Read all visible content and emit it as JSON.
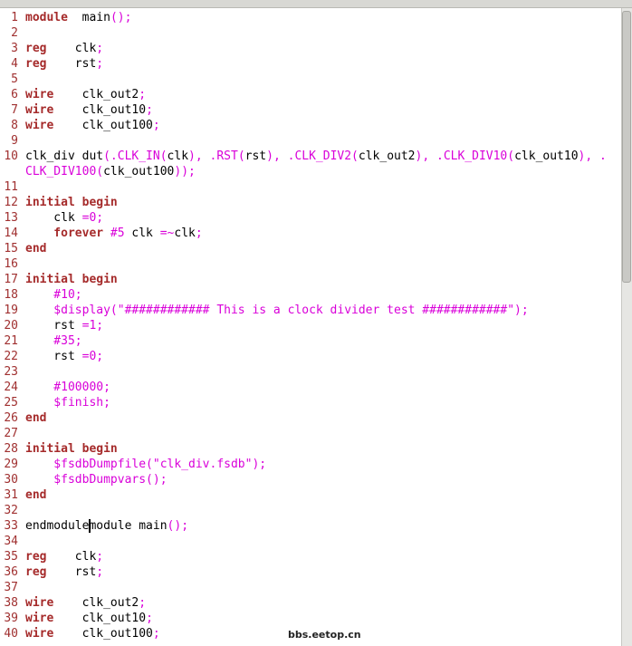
{
  "lines": [
    {
      "n": "1",
      "t": [
        [
          "kw",
          "module"
        ],
        [
          "",
          "  main"
        ],
        [
          "mg",
          "();"
        ]
      ]
    },
    {
      "n": "2",
      "t": []
    },
    {
      "n": "3",
      "t": [
        [
          "kw",
          "reg"
        ],
        [
          "",
          "    clk"
        ],
        [
          "mg",
          ";"
        ]
      ]
    },
    {
      "n": "4",
      "t": [
        [
          "kw",
          "reg"
        ],
        [
          "",
          "    rst"
        ],
        [
          "mg",
          ";"
        ]
      ]
    },
    {
      "n": "5",
      "t": []
    },
    {
      "n": "6",
      "t": [
        [
          "kw",
          "wire"
        ],
        [
          "",
          "    clk_out2"
        ],
        [
          "mg",
          ";"
        ]
      ]
    },
    {
      "n": "7",
      "t": [
        [
          "kw",
          "wire"
        ],
        [
          "",
          "    clk_out10"
        ],
        [
          "mg",
          ";"
        ]
      ]
    },
    {
      "n": "8",
      "t": [
        [
          "kw",
          "wire"
        ],
        [
          "",
          "    clk_out100"
        ],
        [
          "mg",
          ";"
        ]
      ]
    },
    {
      "n": "9",
      "t": []
    },
    {
      "n": "10",
      "t": [
        [
          "",
          "clk_div dut"
        ],
        [
          "mg",
          "(.CLK_IN("
        ],
        [
          "",
          "clk"
        ],
        [
          "mg",
          "), .RST("
        ],
        [
          "",
          "rst"
        ],
        [
          "mg",
          "), .CLK_DIV2("
        ],
        [
          "",
          "clk_out2"
        ],
        [
          "mg",
          "), .CLK_DIV10("
        ],
        [
          "",
          "clk_out10"
        ],
        [
          "mg",
          "), ."
        ]
      ]
    },
    {
      "n": "",
      "t": [
        [
          "mg",
          "CLK_DIV100("
        ],
        [
          "",
          "clk_out100"
        ],
        [
          "mg",
          "));"
        ]
      ]
    },
    {
      "n": "11",
      "t": []
    },
    {
      "n": "12",
      "t": [
        [
          "kw",
          "initial begin"
        ]
      ]
    },
    {
      "n": "13",
      "t": [
        [
          "",
          "    clk "
        ],
        [
          "mg",
          "=0;"
        ]
      ]
    },
    {
      "n": "14",
      "t": [
        [
          "kw",
          "    forever "
        ],
        [
          "mg",
          "#5"
        ],
        [
          "",
          " clk "
        ],
        [
          "mg",
          "=~"
        ],
        [
          "",
          "clk"
        ],
        [
          "mg",
          ";"
        ]
      ]
    },
    {
      "n": "15",
      "t": [
        [
          "kw",
          "end"
        ]
      ]
    },
    {
      "n": "16",
      "t": []
    },
    {
      "n": "17",
      "t": [
        [
          "kw",
          "initial begin"
        ]
      ]
    },
    {
      "n": "18",
      "t": [
        [
          "mg",
          "    #10;"
        ]
      ]
    },
    {
      "n": "19",
      "t": [
        [
          "mg",
          "    $display(\"############ This is a clock divider test ############\");"
        ]
      ]
    },
    {
      "n": "20",
      "t": [
        [
          "",
          "    rst "
        ],
        [
          "mg",
          "=1;"
        ]
      ]
    },
    {
      "n": "21",
      "t": [
        [
          "mg",
          "    #35;"
        ]
      ]
    },
    {
      "n": "22",
      "t": [
        [
          "",
          "    rst "
        ],
        [
          "mg",
          "=0;"
        ]
      ]
    },
    {
      "n": "23",
      "t": []
    },
    {
      "n": "24",
      "t": [
        [
          "mg",
          "    #100000;"
        ]
      ]
    },
    {
      "n": "25",
      "t": [
        [
          "mg",
          "    $finish;"
        ]
      ]
    },
    {
      "n": "26",
      "t": [
        [
          "kw",
          "end"
        ]
      ]
    },
    {
      "n": "27",
      "t": []
    },
    {
      "n": "28",
      "t": [
        [
          "kw",
          "initial begin"
        ]
      ]
    },
    {
      "n": "29",
      "t": [
        [
          "mg",
          "    $fsdbDumpfile(\"clk_div.fsdb\");"
        ]
      ]
    },
    {
      "n": "30",
      "t": [
        [
          "mg",
          "    $fsdbDumpvars();"
        ]
      ]
    },
    {
      "n": "31",
      "t": [
        [
          "kw",
          "end"
        ]
      ]
    },
    {
      "n": "32",
      "t": []
    },
    {
      "n": "33",
      "t": [
        [
          "",
          "endmodulemodule main"
        ],
        [
          "mg",
          "();"
        ]
      ]
    },
    {
      "n": "34",
      "t": []
    },
    {
      "n": "35",
      "t": [
        [
          "kw",
          "reg"
        ],
        [
          "",
          "    clk"
        ],
        [
          "mg",
          ";"
        ]
      ]
    },
    {
      "n": "36",
      "t": [
        [
          "kw",
          "reg"
        ],
        [
          "",
          "    rst"
        ],
        [
          "mg",
          ";"
        ]
      ]
    },
    {
      "n": "37",
      "t": []
    },
    {
      "n": "38",
      "t": [
        [
          "kw",
          "wire"
        ],
        [
          "",
          "    clk_out2"
        ],
        [
          "mg",
          ";"
        ]
      ]
    },
    {
      "n": "39",
      "t": [
        [
          "kw",
          "wire"
        ],
        [
          "",
          "    clk_out10"
        ],
        [
          "mg",
          ";"
        ]
      ]
    },
    {
      "n": "40",
      "t": [
        [
          "kw",
          "wire"
        ],
        [
          "",
          "    clk_out100"
        ],
        [
          "mg",
          ";"
        ]
      ]
    }
  ],
  "watermark": "bbs.eetop.cn",
  "colors": {
    "keyword": "#a52a2a",
    "literal": "#d900d9",
    "line_number": "#a03030"
  }
}
